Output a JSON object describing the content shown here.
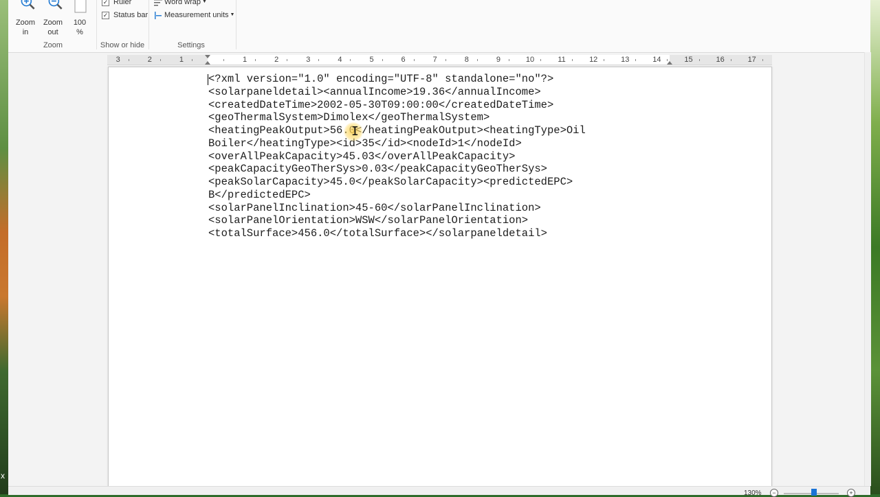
{
  "ribbon": {
    "zoom_in": "Zoom\nin",
    "zoom_in_l1": "Zoom",
    "zoom_in_l2": "in",
    "zoom_out_l1": "Zoom",
    "zoom_out_l2": "out",
    "zoom_pct_l1": "100",
    "zoom_pct_l2": "%",
    "zoom_group": "Zoom",
    "ruler_label": "Ruler",
    "statusbar_label": "Status bar",
    "show_hide_group": "Show or hide",
    "word_wrap": "Word wrap",
    "measurement_units": "Measurement units",
    "settings_group": "Settings"
  },
  "ruler": {
    "labels": [
      "3",
      "2",
      "1",
      "1",
      "2",
      "3",
      "4",
      "5",
      "6",
      "7",
      "8",
      "9",
      "10",
      "11",
      "12",
      "13",
      "14",
      "15",
      "16",
      "17"
    ]
  },
  "document": {
    "lines": [
      "<?xml version=\"1.0\" encoding=\"UTF-8\" standalone=\"no\"?>",
      "<solarpaneldetail><annualIncome>19.36</annualIncome>",
      "<createdDateTime>2002-05-30T09:00:00</createdDateTime>",
      "<geoThermalSystem>Dimolex</geoThermalSystem>",
      "<heatingPeakOutput>56.0</heatingPeakOutput><heatingType>Oil",
      "Boiler</heatingType><id>35</id><nodeId>1</nodeId>",
      "<overAllPeakCapacity>45.03</overAllPeakCapacity>",
      "<peakCapacityGeoTherSys>0.03</peakCapacityGeoTherSys>",
      "<peakSolarCapacity>45.0</peakSolarCapacity><predictedEPC>",
      "B</predictedEPC>",
      "<solarPanelInclination>45-60</solarPanelInclination>",
      "<solarPanelOrientation>WSW</solarPanelOrientation>",
      "<totalSurface>456.0</totalSurface></solarpaneldetail>"
    ]
  },
  "status": {
    "zoom_value": "130%"
  },
  "colors": {
    "accent": "#1a73d6",
    "zoom_icon": "#2a7fd4"
  }
}
